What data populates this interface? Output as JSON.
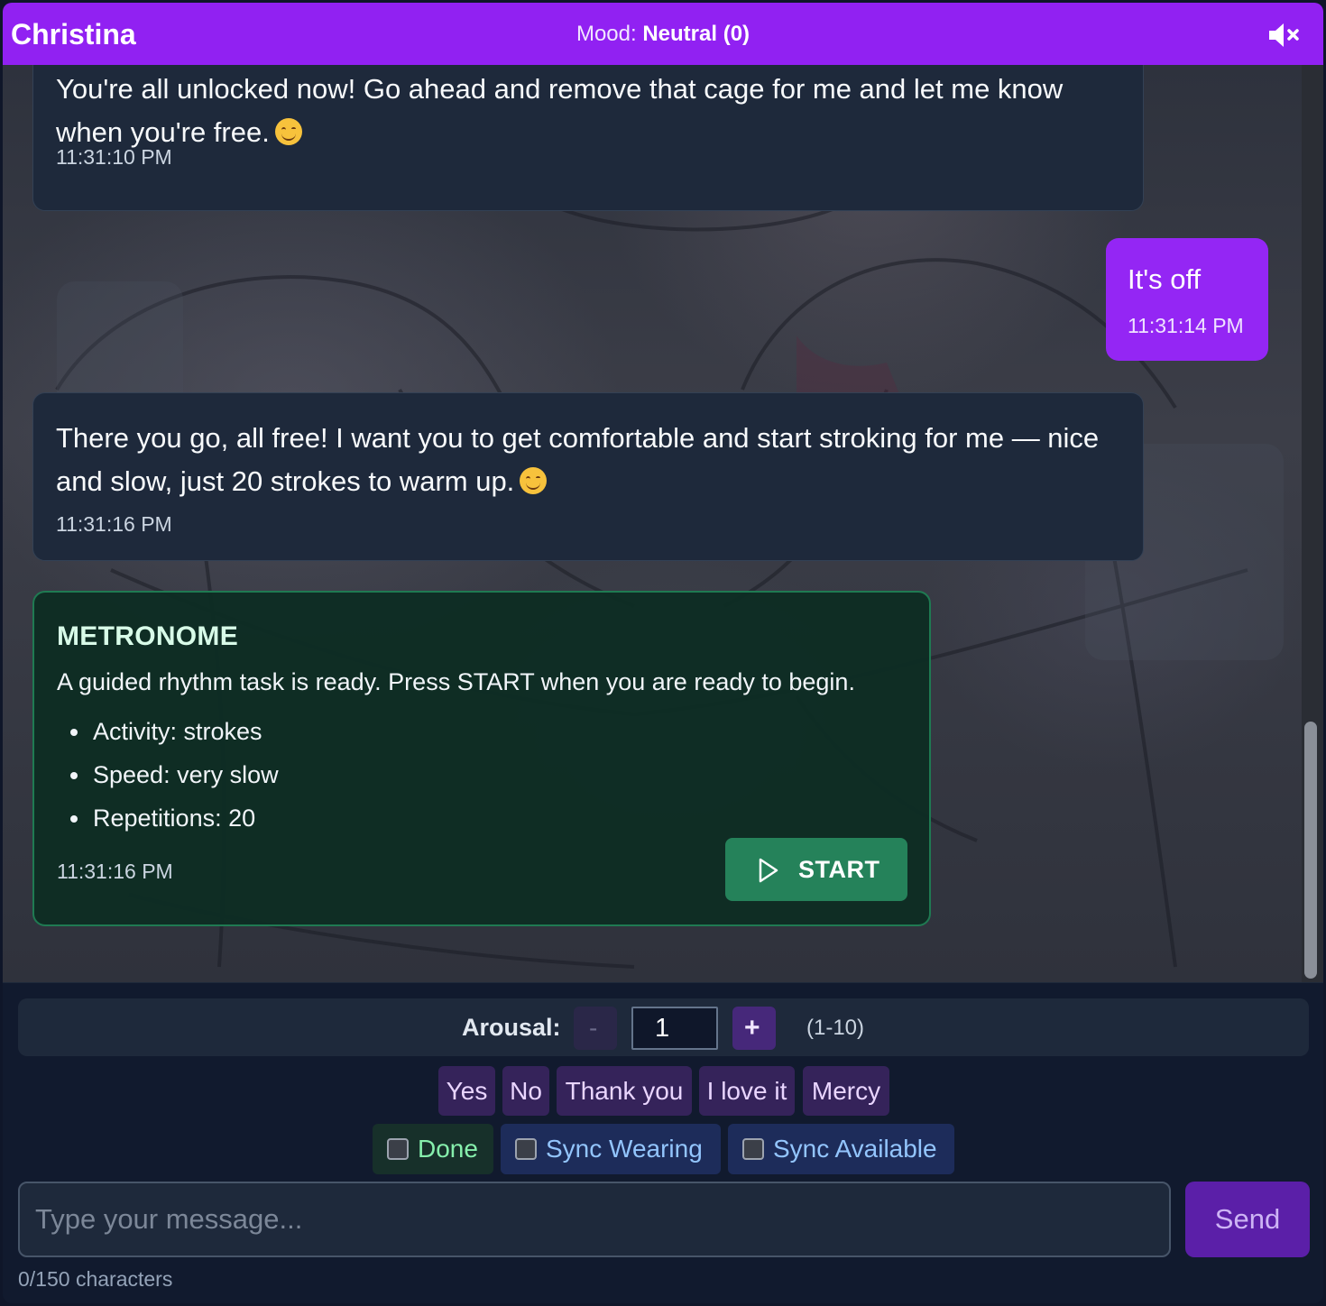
{
  "header": {
    "title": "Christina",
    "mood_label": "Mood:",
    "mood_value": "Neutral (0)",
    "mute_icon": "speaker-muted-icon"
  },
  "messages": [
    {
      "sender": "assistant",
      "text": "You're all unlocked now! Go ahead and remove that cage for me and let me know when you're free.",
      "emoji": "smiling-face-icon",
      "time": "11:31:10 PM"
    },
    {
      "sender": "user",
      "text": "It's off",
      "time": "11:31:14 PM"
    },
    {
      "sender": "assistant",
      "text": "There you go, all free! I want you to get comfortable and start stroking for me — nice and slow, just 20 strokes to warm up.",
      "emoji": "smiling-face-icon",
      "time": "11:31:16 PM"
    }
  ],
  "metronome": {
    "title": "METRONOME",
    "description": "A guided rhythm task is ready. Press START when you are ready to begin.",
    "details": [
      "Activity: strokes",
      "Speed: very slow",
      "Repetitions: 20"
    ],
    "time": "11:31:16 PM",
    "start_label": "START",
    "start_icon": "play-icon"
  },
  "arousal": {
    "label": "Arousal:",
    "minus_label": "-",
    "value": "1",
    "plus_label": "+",
    "range": "(1-10)"
  },
  "quick_replies": [
    "Yes",
    "No",
    "Thank you",
    "I love it",
    "Mercy"
  ],
  "checkboxes": [
    {
      "label": "Done",
      "checked": false
    },
    {
      "label": "Sync Wearing",
      "checked": false
    },
    {
      "label": "Sync Available",
      "checked": false
    }
  ],
  "composer": {
    "placeholder": "Type your message...",
    "value": "",
    "send_label": "Send",
    "counter": "0/150 characters"
  },
  "colors": {
    "header": "#9121f2",
    "user_bubble": "#9426f4",
    "metronome_border": "#1f7a52",
    "start_button": "#25825a",
    "send_button": "#5b1fa8"
  }
}
